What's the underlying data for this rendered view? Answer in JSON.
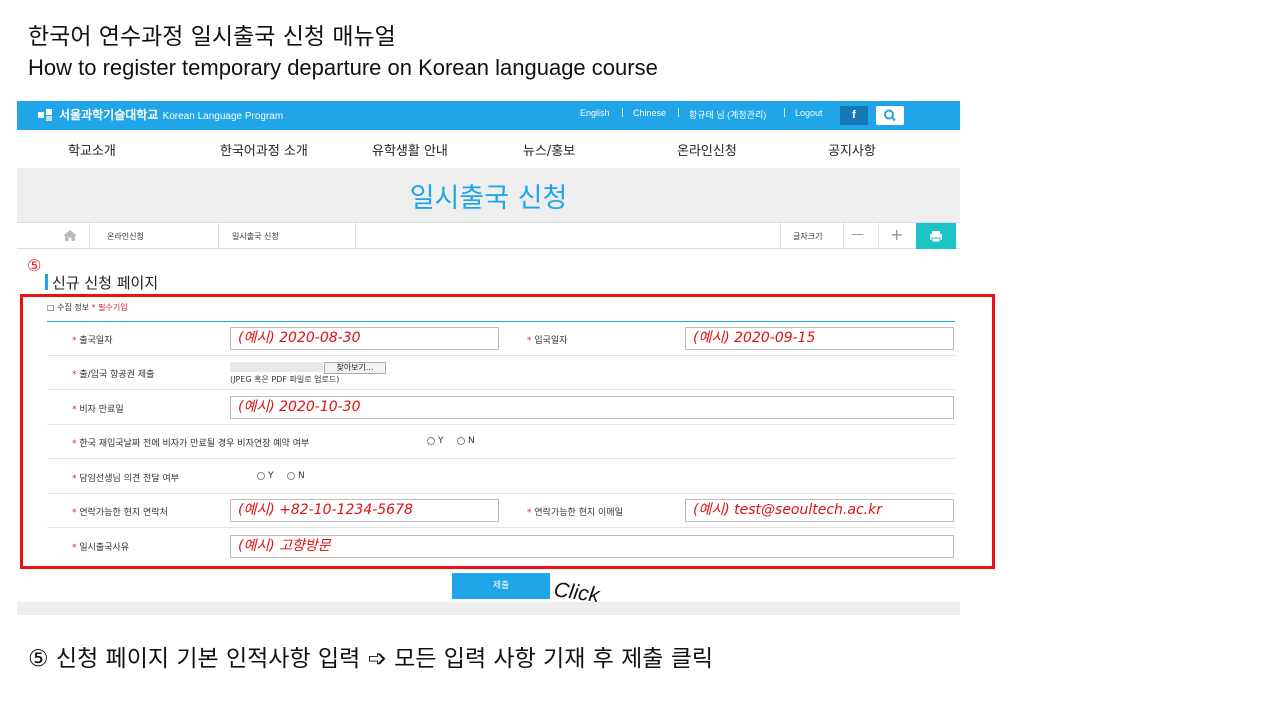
{
  "slide": {
    "title": "한국어 연수과정 일시출국 신청 매뉴얼",
    "subtitle": "How to register temporary departure on Korean language course",
    "click_note": "Click",
    "caption": "⑤ 신청 페이지 기본 인적사항 입력 ➩ 모든 입력 사항 기재 후 제출 클릭"
  },
  "site": {
    "logo_text": "서울과학기술대학교",
    "logo_program": "Korean Language Program",
    "util_links": [
      "English",
      "Chinese",
      "황규태 님 (계정관리)",
      "Logout"
    ],
    "fb_label": "f",
    "nav": [
      "학교소개",
      "한국어과정 소개",
      "유학생활 안내",
      "뉴스/홍보",
      "온라인신청",
      "공지사항"
    ],
    "banner_title": "일시출국 신청",
    "breadcrumb": [
      "온라인신청",
      "일시출국 신청"
    ],
    "font_size_label": "글자크기",
    "minus": "—",
    "plus": "+"
  },
  "form": {
    "step_marker": "⑤",
    "section_title": "신규 신청 페이지",
    "legend": "□ 수집 정보",
    "legend_req": "* 필수기입",
    "req_mark": "*",
    "departure_date": {
      "label": "출국일자",
      "example": "(예시) 2020-08-30"
    },
    "entry_date": {
      "label": "입국일자",
      "example": "(예시) 2020-09-15"
    },
    "ticket": {
      "label": "출/입국 항공권 제출",
      "button": "찾아보기...",
      "hint": "(JPEG 혹은 PDF 파일로 업로드)"
    },
    "visa_expiry": {
      "label": "비자 만료일",
      "example": "(예시) 2020-10-30"
    },
    "visa_extension": {
      "label": "한국 재입국날짜 전에 비자가 만료될 경우 비자연장 예약 여부",
      "yes": "Y",
      "no": "N"
    },
    "teacher_notice": {
      "label": "담임선생님 의견 전달 여부",
      "yes": "Y",
      "no": "N"
    },
    "local_phone": {
      "label": "연락가능한 현지 연락처",
      "example": "(예시) +82-10-1234-5678"
    },
    "local_email": {
      "label": "연락가능한 현지 이메일",
      "example": "(예시) test@seoultech.ac.kr"
    },
    "reason": {
      "label": "일시출국사유",
      "example": "(예시) 고향방문"
    },
    "submit": "제출"
  },
  "colors": {
    "accent": "#1fa5e8",
    "highlight": "#e11111",
    "example_text": "#d11111",
    "print": "#1cc6c6"
  }
}
